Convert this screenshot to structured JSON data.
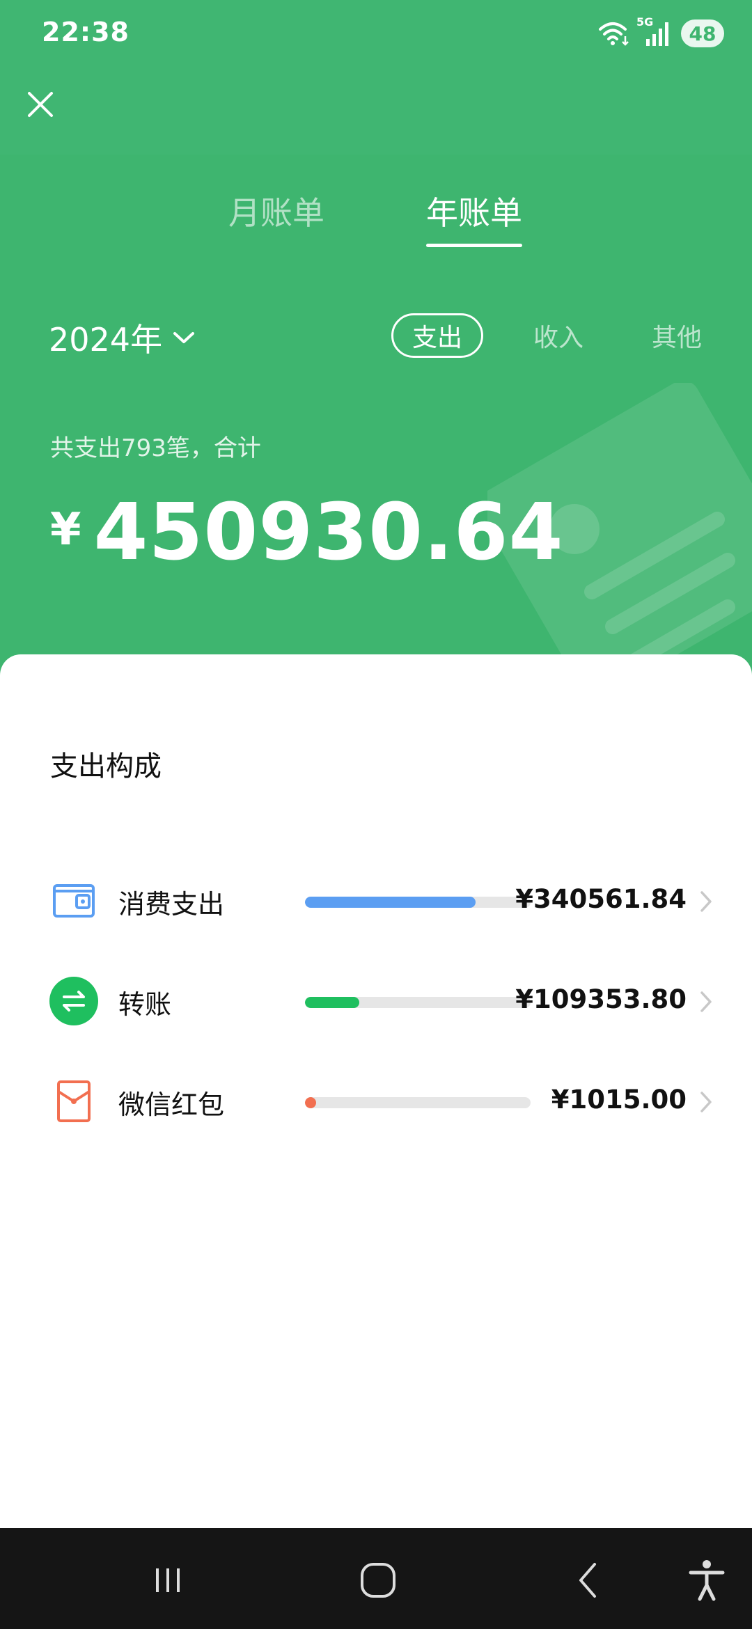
{
  "status_bar": {
    "time": "22:38",
    "network": "5G",
    "battery": "48",
    "icons": [
      "wifi-icon",
      "signal-icon",
      "battery-icon"
    ]
  },
  "header": {
    "close_icon": "close-icon",
    "tabs": [
      {
        "label": "月账单",
        "active": false
      },
      {
        "label": "年账单",
        "active": true
      }
    ],
    "year_selector": {
      "label": "2024年",
      "icon": "chevron-down-icon"
    },
    "filters": [
      {
        "label": "支出",
        "active": true
      },
      {
        "label": "收入",
        "active": false
      },
      {
        "label": "其他",
        "active": false
      }
    ],
    "summary_caption": "共支出793笔，合计",
    "currency_symbol": "¥",
    "total_amount": "450930.64"
  },
  "breakdown": {
    "title": "支出构成",
    "items": [
      {
        "label": "消费支出",
        "amount": "¥340561.84",
        "fraction": 0.755,
        "color": "#5b9ef2",
        "icon": "wallet-icon"
      },
      {
        "label": "转账",
        "amount": "¥109353.80",
        "fraction": 0.242,
        "color": "#1fbf5f",
        "icon": "transfer-icon"
      },
      {
        "label": "微信红包",
        "amount": "¥1015.00",
        "fraction": 0.0023,
        "color": "#f26f50",
        "icon": "red-packet-icon"
      }
    ]
  },
  "colors": {
    "header_green": "#3eb56f",
    "text_dark": "#111111",
    "track_gray": "#e6e6e6"
  },
  "navbar": {
    "buttons": [
      "recent-apps-icon",
      "home-icon",
      "back-icon",
      "accessibility-icon"
    ]
  }
}
